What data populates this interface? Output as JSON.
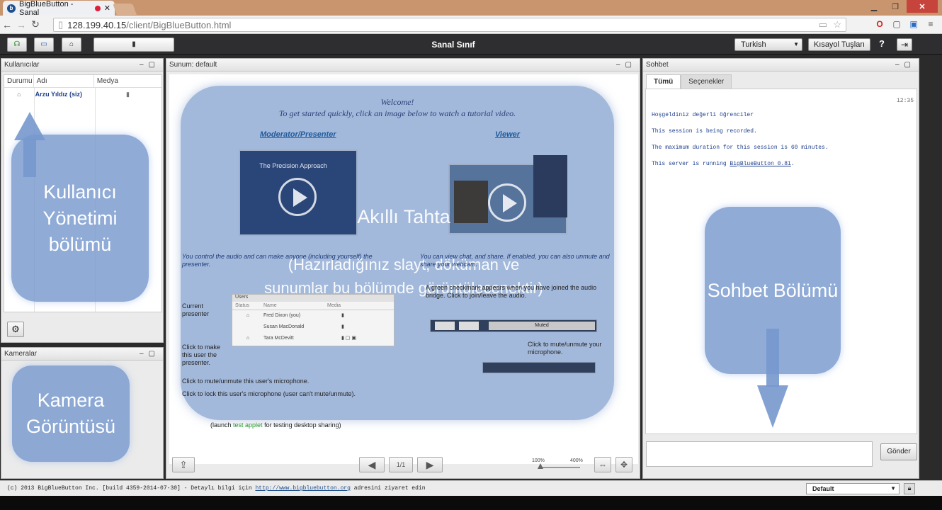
{
  "browser": {
    "tab_title": "BigBlueButton - Sanal",
    "favicon": "b",
    "url_host": "128.199.40.15",
    "url_path": "/client/BigBlueButton.html"
  },
  "toolbar": {
    "title": "Sanal Sınıf",
    "language": "Turkish",
    "shortcuts_label": "Kısayol Tuşları",
    "help_label": "?",
    "icons": [
      "headset-icon",
      "desktop-share-icon",
      "webcam-icon",
      "microphone-icon",
      "logout-icon"
    ]
  },
  "users_panel": {
    "title": "Kullanıcılar",
    "col_status": "Durumu",
    "col_name": "Adı",
    "col_media": "Medya",
    "users": [
      {
        "name": "Arzu Yıldız (siz)"
      }
    ],
    "callout": "Kullanıcı Yönetimi bölümü"
  },
  "cameras_panel": {
    "title": "Kameralar",
    "callout": "Kamera Görüntüsü"
  },
  "presentation": {
    "title": "Sunum: default",
    "welcome": "Welcome!",
    "get_started": "To get started quickly, click an image below to watch a tutorial video.",
    "moderator_link": "Moderator/Presenter",
    "viewer_link": "Viewer",
    "video_caption": "The Precision Approach",
    "overlay_title": "Akıllı Tahta",
    "overlay_sub1": "(Hazırladığınız slayt, döküman ve",
    "overlay_sub2": "sunumlar bu bölümde görüntülecenektir)",
    "left_text": "You control the audio and can make anyone (including yourself) the presenter.",
    "right_text": "You can view chat, and share. If enabled, you can also unmute and share your webcam.",
    "checkmark_text": "A green checkmark appears when you have joined the audio bridge. Click to join/leave the audio.",
    "current_presenter": "Current presenter",
    "click_make": "Click to make this user the presenter.",
    "click_mute": "Click to mute/unmute this user's microphone.",
    "click_lock": "Click to lock this user's microphone (user can't mute/unmute).",
    "click_mute_your": "Click to mute/unmute your microphone.",
    "mini_users": "Users",
    "mini_status": "Status",
    "mini_name": "Name",
    "mini_media": "Media",
    "mini_rows": [
      "Fred Dixon (you)",
      "Susan MacDonald",
      "Tara McDevitt"
    ],
    "muted_label": "Muted",
    "launch_prefix": "(launch ",
    "launch_link": "test applet",
    "launch_suffix": " for testing desktop sharing)",
    "page": "1/1",
    "zoom_min": "100%",
    "zoom_max": "400%"
  },
  "chat_panel": {
    "title": "Sohbet",
    "tab_all": "Tümü",
    "tab_options": "Seçenekler",
    "time": "12:35",
    "messages": [
      "Hoşgeldiniz değerli öğrenciler",
      "This session is being recorded.",
      "The maximum duration for this session is 60 minutes."
    ],
    "server_prefix": "This server is running ",
    "server_link": "BigBlueButton 0.81",
    "server_suffix": ".",
    "send_label": "Gönder",
    "callout": "Sohbet Bölümü"
  },
  "footer": {
    "copyright": "(c) 2013 BigBlueButton Inc. [build 4359-2014-07-30] - Detaylı bilgi için ",
    "link": "http://www.bigbluebutton.org",
    "suffix": " adresini ziyaret edin",
    "layout": "Default"
  },
  "colors": {
    "callout": "#7698cd",
    "toolbar": "#2e2e30",
    "tabbar": "#c9956f",
    "link": "#1f4f8c"
  }
}
